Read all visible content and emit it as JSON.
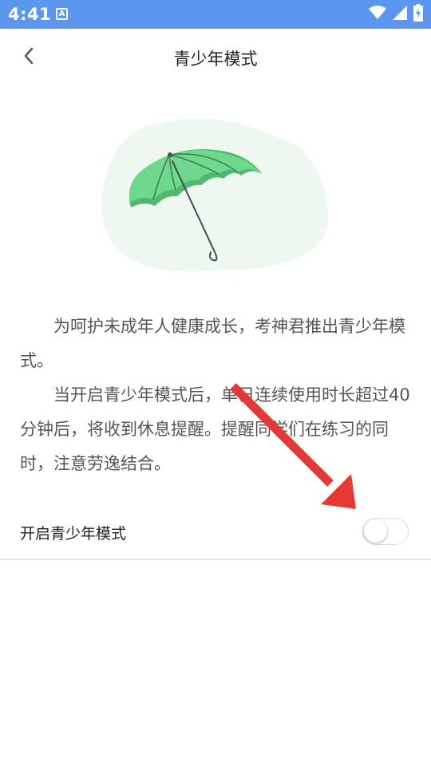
{
  "status_bar": {
    "time": "4:41",
    "notification_glyph": "A",
    "icons": [
      "wifi-icon",
      "signal-icon",
      "battery-charging-icon"
    ],
    "color": "#5b97ee"
  },
  "header": {
    "title": "青少年模式",
    "back_icon": "chevron-left-icon"
  },
  "illustration": {
    "icon": "umbrella-icon",
    "umbrella_color": "#6fd88c",
    "background_color": "#eef7f0"
  },
  "description": {
    "paragraph_1": "为呵护未成年人健康成长，考神君推出青少年模式。",
    "paragraph_2": "当开启青少年模式后，单日连续使用时长超过40分钟后，将收到休息提醒。提醒同学们在练习的同时，注意劳逸结合。"
  },
  "settings": {
    "toggle_label": "开启青少年模式",
    "toggle_on": false
  },
  "annotation": {
    "arrow_color": "#e53935"
  }
}
